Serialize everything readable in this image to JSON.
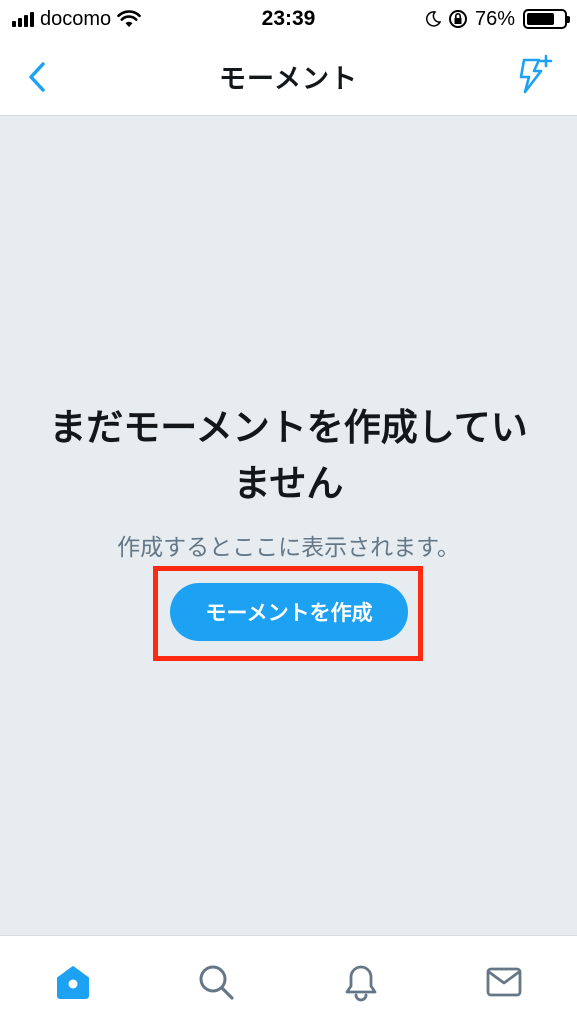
{
  "status_bar": {
    "carrier": "docomo",
    "time": "23:39",
    "battery_percent": "76%",
    "battery_level": 0.76
  },
  "nav": {
    "title": "モーメント",
    "back_icon": "chevron-left-icon",
    "action_icon": "lightning-plus-icon"
  },
  "empty_state": {
    "title": "まだモーメントを作成していません",
    "subtitle": "作成するとここに表示されます。",
    "button_label": "モーメントを作成"
  },
  "tabs": [
    {
      "icon": "home-icon",
      "active": true
    },
    {
      "icon": "search-icon",
      "active": false
    },
    {
      "icon": "bell-icon",
      "active": false
    },
    {
      "icon": "mail-icon",
      "active": false
    }
  ],
  "colors": {
    "accent": "#1da1f2",
    "background": "#e6ecf0",
    "highlight": "#ff2a12",
    "text_primary": "#14171a",
    "text_secondary": "#657786",
    "icon_inactive": "#657786"
  }
}
